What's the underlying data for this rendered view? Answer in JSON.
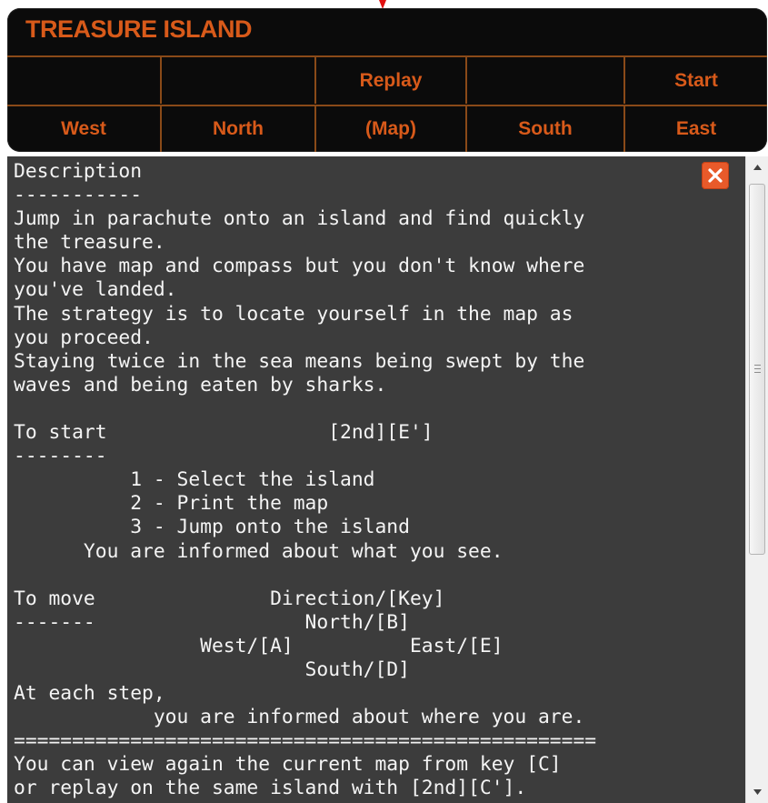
{
  "header": {
    "title": "TREASURE ISLAND",
    "accent_color": "#d85a1a",
    "background_color": "#0b0b0b"
  },
  "controls": {
    "row1": [
      "",
      "",
      "Replay",
      "",
      "Start"
    ],
    "row2": [
      "West",
      "North",
      "(Map)",
      "South",
      "East"
    ]
  },
  "content": {
    "text": "Description\n-----------\nJump in parachute onto an island and find quickly\nthe treasure.\nYou have map and compass but you don't know where\nyou've landed.\nThe strategy is to locate yourself in the map as\nyou proceed.\nStaying twice in the sea means being swept by the\nwaves and being eaten by sharks.\n\nTo start                   [2nd][E']\n--------\n          1 - Select the island\n          2 - Print the map\n          3 - Jump onto the island\n      You are informed about what you see.\n\nTo move               Direction/[Key]\n-------                  North/[B]\n                West/[A]          East/[E]\n                         South/[D]\nAt each step,\n            you are informed about where you are.\n==================================================\nYou can view again the current map from key [C]\nor replay on the same island with [2nd][C'].",
    "background_color": "#3c3c3c",
    "close_icon": "close-x-icon",
    "close_color": "#e85a2a"
  },
  "scrollbar": {
    "up_icon": "scroll-up-arrow-icon",
    "down_icon": "scroll-down-arrow-icon",
    "grip_icon": "grip-lines-icon",
    "position": 0.0
  }
}
